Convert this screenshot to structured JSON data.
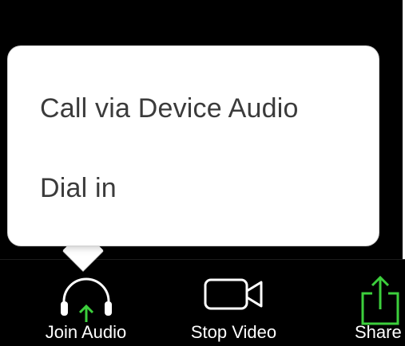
{
  "audio_menu": {
    "items": [
      {
        "label": "Call via Device Audio"
      },
      {
        "label": "Dial in"
      }
    ]
  },
  "toolbar": {
    "join_audio": {
      "label": "Join Audio",
      "icon": "headphones-icon"
    },
    "stop_video": {
      "label": "Stop Video",
      "icon": "video-camera-icon"
    },
    "share": {
      "label": "Share",
      "icon": "share-icon"
    }
  },
  "colors": {
    "background": "#000000",
    "popup": "#ffffff",
    "menu_text": "#3b3b3b",
    "accent_green": "#3ccf3c",
    "toolbar_text": "#ffffff"
  }
}
